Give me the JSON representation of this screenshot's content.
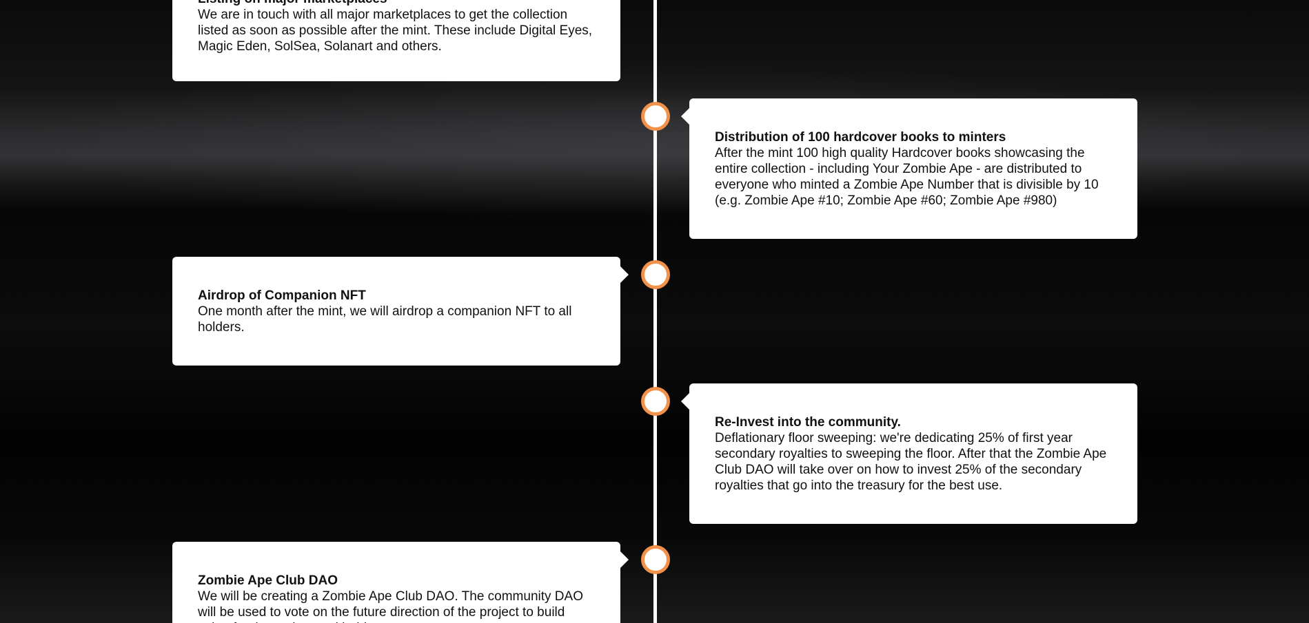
{
  "roadmap": {
    "items": [
      {
        "title": "Listing on major marketplaces",
        "text": "We are in touch with all major marketplaces to get the collection listed as soon as possible after the mint. These include Digital Eyes, Magic Eden, SolSea, Solanart and others."
      },
      {
        "title": "Distribution of 100 hardcover books to minters",
        "text": "After the mint 100 high quality Hardcover books showcasing the entire collection - including Your Zombie Ape - are distributed to everyone who minted a Zombie Ape Number that is divisible by 10 (e.g. Zombie Ape #10; Zombie Ape #60; Zombie Ape #980)"
      },
      {
        "title": "Airdrop of Companion NFT",
        "text": "One month after the mint, we will airdrop a companion NFT to all holders."
      },
      {
        "title": "Re-Invest into the community.",
        "text": "Deflationary floor sweeping: we're dedicating 25% of first year secondary royalties to sweeping the floor. After that the Zombie Ape Club DAO will take over on how to invest 25% of the secondary royalties that go into the treasury for the best use."
      },
      {
        "title": "Zombie Ape Club DAO",
        "text": "We will be creating a Zombie Ape Club DAO. The community DAO will be used to vote on the future direction of the project to build value for the project and holders."
      }
    ]
  },
  "colors": {
    "node_border": "#f2914a",
    "line": "#ffffff",
    "card_background": "#ffffff",
    "page_background": "#060606"
  }
}
